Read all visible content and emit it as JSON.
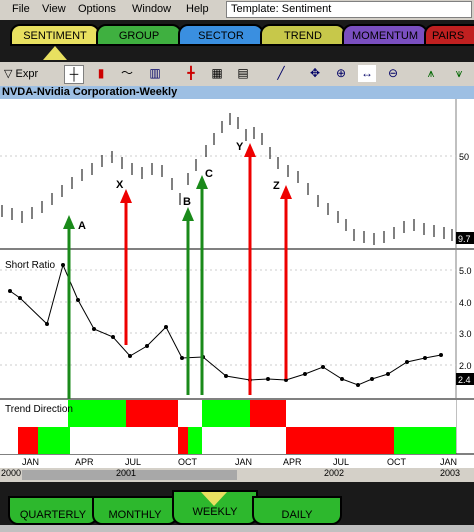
{
  "menu": {
    "file": "File",
    "view": "View",
    "options": "Options",
    "window": "Window",
    "help": "Help"
  },
  "template_label": "Template: Sentiment",
  "top_tabs": [
    {
      "label": "SENTIMENT",
      "color": "#e8e060",
      "active": true
    },
    {
      "label": "GROUP",
      "color": "#3fb040"
    },
    {
      "label": "SECTOR",
      "color": "#3a8fe0"
    },
    {
      "label": "TREND",
      "color": "#c7c84a"
    },
    {
      "label": "MOMENTUM",
      "color": "#7a4fc0"
    },
    {
      "label": "PAIRS",
      "color": "#c02020"
    }
  ],
  "toolbar": {
    "expr_label": "Expr"
  },
  "chart_title": "NVDA-Nvidia Corporation-Weekly",
  "panels": {
    "price_label_50": "50",
    "price_last": "9.7",
    "short_ratio_title": "Short Ratio",
    "short_ticks": [
      "5.0",
      "4.0",
      "3.0",
      "2.0"
    ],
    "short_last": "2.4",
    "trend_title": "Trend Direction"
  },
  "markers": [
    "A",
    "X",
    "B",
    "C",
    "Y",
    "Z"
  ],
  "axis": {
    "months": [
      "JAN",
      "APR",
      "JUL",
      "OCT",
      "JAN",
      "APR",
      "JUL",
      "OCT",
      "JAN"
    ],
    "years": [
      "2000",
      "2001",
      "2002",
      "2003"
    ]
  },
  "bottom_tabs": [
    {
      "label": "QUARTERLY"
    },
    {
      "label": "MONTHLY"
    },
    {
      "label": "WEEKLY",
      "active": true
    },
    {
      "label": "DAILY"
    }
  ],
  "colors": {
    "trend_up": "#00ff00",
    "trend_down": "#ff0000",
    "arrow_buy": "#1a8a1a",
    "arrow_sell": "#ee0000",
    "title_bg": "#9dbfe3"
  }
}
